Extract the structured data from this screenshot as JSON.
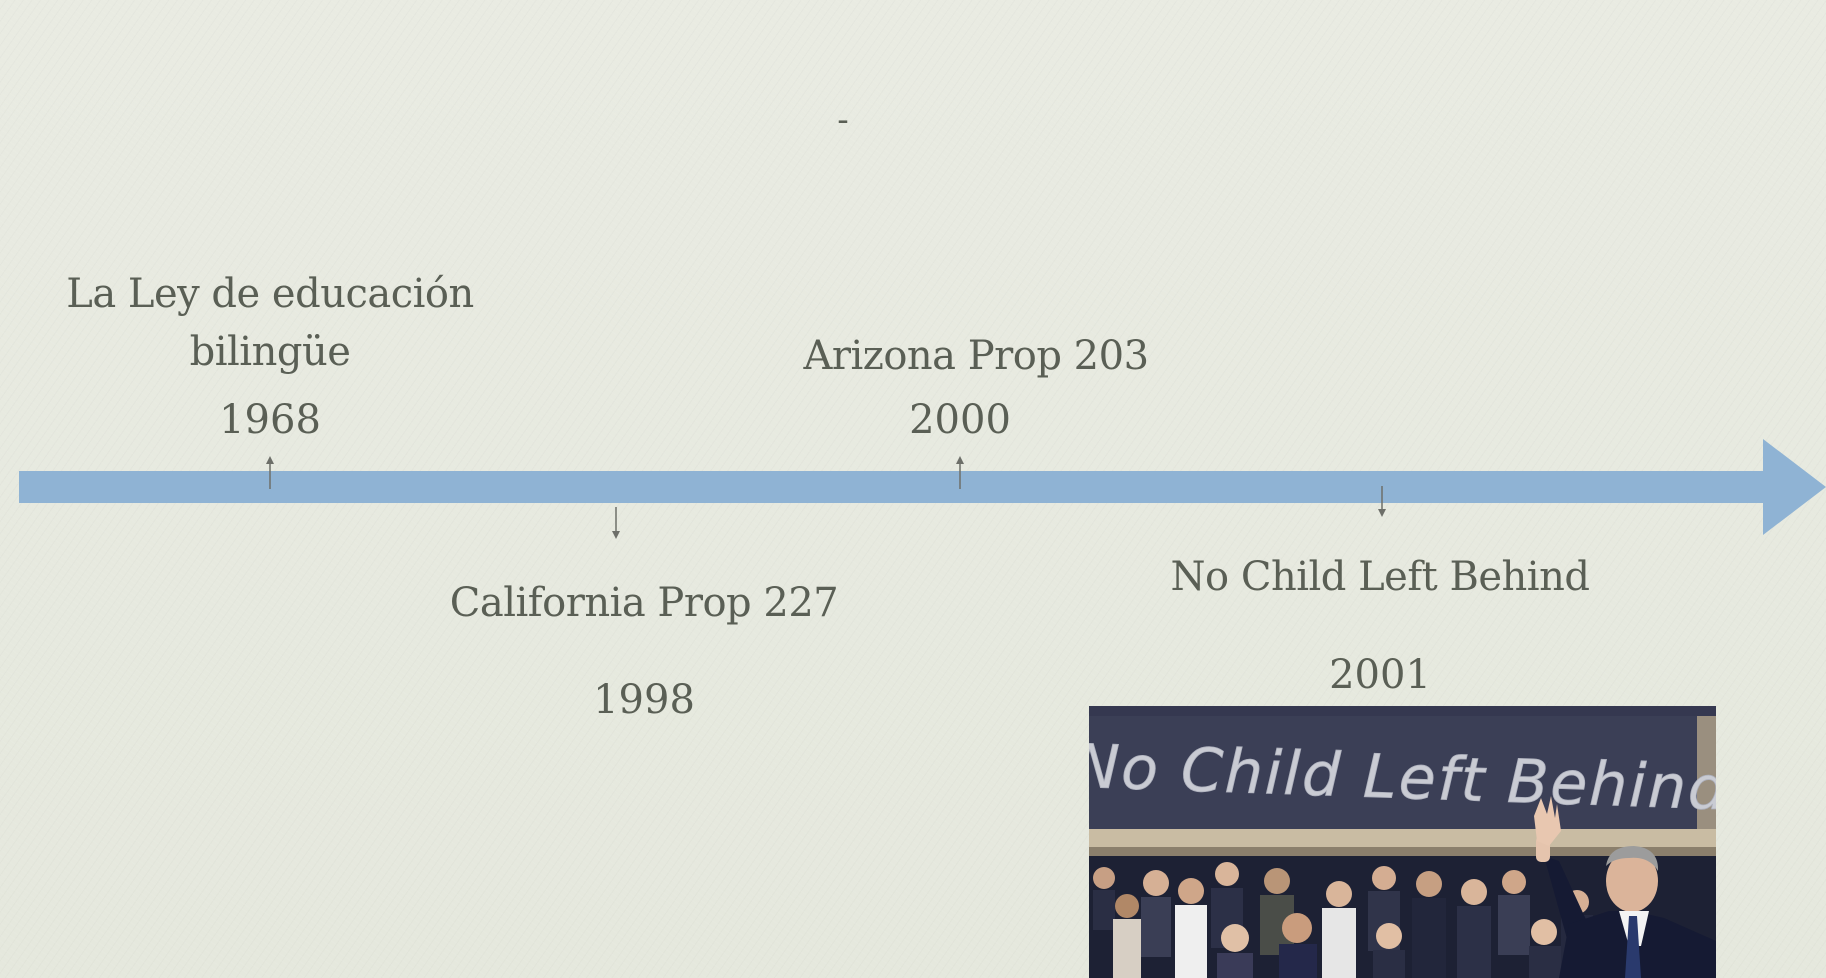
{
  "slide": {
    "title": "-"
  },
  "timeline": {
    "arrow_color": "#8fb3d4",
    "events": [
      {
        "title": "La Ley de educación bilingüe",
        "year": "1968",
        "side": "above"
      },
      {
        "title": "California Prop 227",
        "year": "1998",
        "side": "below"
      },
      {
        "title": "Arizona Prop 203",
        "year": "2000",
        "side": "above"
      },
      {
        "title": "No Child Left Behind",
        "year": "2001",
        "side": "below"
      }
    ]
  },
  "photo": {
    "chalkboard_text": "No Child Left Behind"
  }
}
